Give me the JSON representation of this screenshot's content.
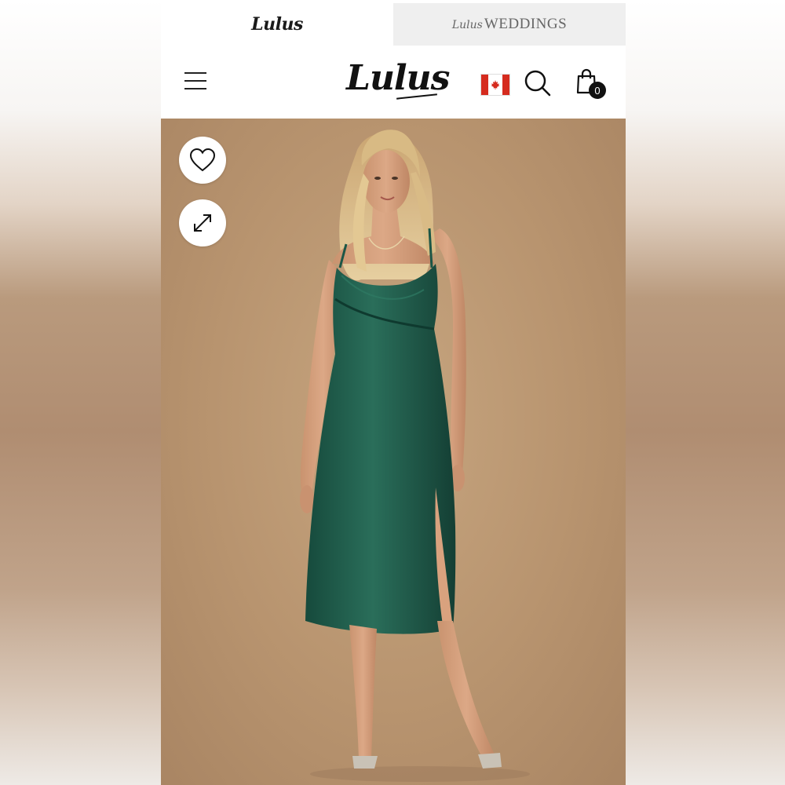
{
  "tabs": {
    "lulus_label": "Lulus",
    "weddings_brand": "Lulus",
    "weddings_label": "WEDDINGS"
  },
  "header": {
    "logo_text": "Lulus",
    "cart_count": "0",
    "country": "Canada"
  },
  "hero": {
    "wishlist_icon": "heart-icon",
    "zoom_icon": "expand-icon",
    "dress_color": "#1f5a4a",
    "background_color": "#b8946f"
  },
  "colors": {
    "tab_inactive": "#efefef",
    "flag_red": "#d52b1e",
    "text_dark": "#111111"
  }
}
